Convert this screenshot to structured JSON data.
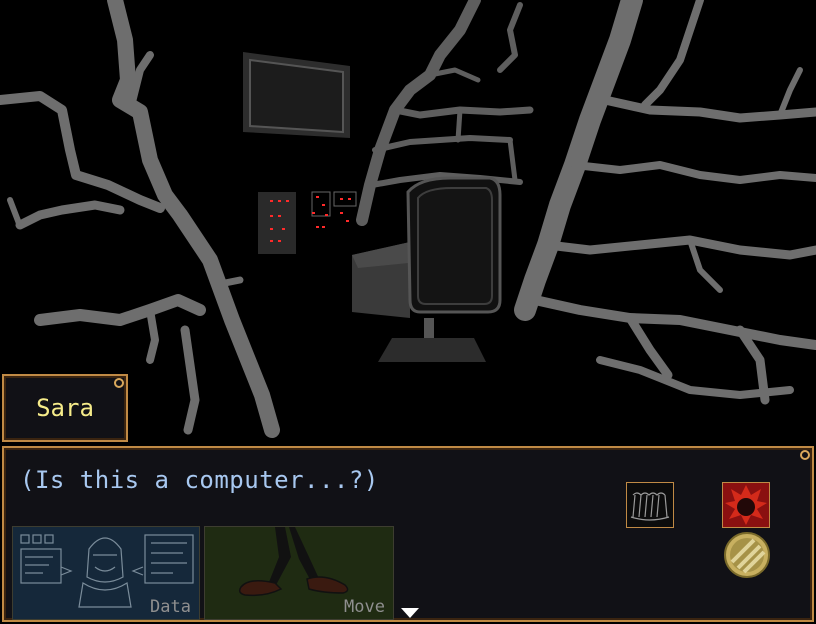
{
  "speaker": {
    "name": "Sara"
  },
  "dialogue": {
    "text": "(Is this a computer...?)"
  },
  "commands": [
    {
      "label": "Data",
      "icon": "profile-data-icon"
    },
    {
      "label": "Move",
      "icon": "walking-legs-icon"
    }
  ],
  "side_icons": [
    "scroll-icon",
    "demon-fire-icon",
    "gold-coin-icon"
  ],
  "colors": {
    "frame": "#c08a45",
    "name_text": "#f6ec8a",
    "dialogue_text": "#a8c8f0",
    "crack": "#6e6e6e",
    "background": "#000000",
    "led": "#ff2a2a"
  }
}
